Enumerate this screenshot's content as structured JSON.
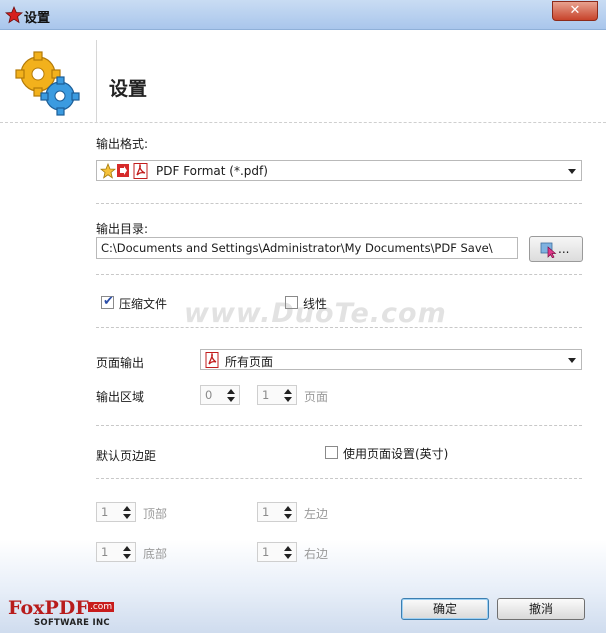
{
  "window": {
    "title": "设置",
    "close_label": "✕"
  },
  "header": {
    "title": "设置"
  },
  "output_format": {
    "label": "输出格式:",
    "value": "PDF Format (*.pdf)"
  },
  "output_dir": {
    "label": "输出目录:",
    "value": "C:\\Documents and Settings\\Administrator\\My Documents\\PDF Save\\",
    "browse_label": "..."
  },
  "options": {
    "compress_label": "压缩文件",
    "compress_checked": true,
    "linear_label": "线性",
    "linear_checked": false
  },
  "page_output": {
    "label": "页面输出",
    "value": "所有页面"
  },
  "output_range": {
    "label": "输出区域",
    "from": "0",
    "to": "1",
    "unit_label": "页面"
  },
  "margins": {
    "label": "默认页边距",
    "use_page_setting_label": "使用页面设置(英寸)",
    "use_page_setting_checked": false,
    "top": {
      "value": "1",
      "label": "顶部"
    },
    "left": {
      "value": "1",
      "label": "左边"
    },
    "bottom": {
      "value": "1",
      "label": "底部"
    },
    "right": {
      "value": "1",
      "label": "右边"
    }
  },
  "buttons": {
    "ok": "确定",
    "cancel": "撤消"
  },
  "logo": {
    "brand": "FoxPDF",
    "com": ".com",
    "sub": "SOFTWARE INC"
  },
  "watermark": "www.DuoTe.com",
  "colors": {
    "titlebar": "#b4cdee",
    "accent": "#3c7fb1",
    "logo_red": "#b81c1c"
  }
}
